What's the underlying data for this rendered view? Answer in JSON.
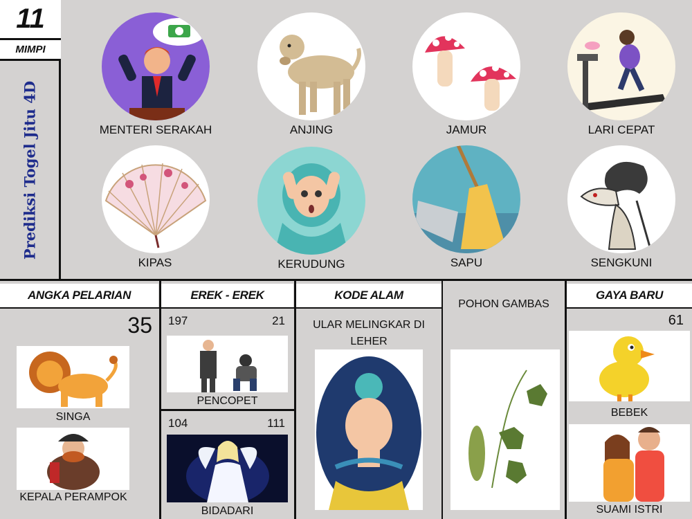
{
  "header": {
    "number": "11",
    "category": "MIMPI",
    "vertical_title": "Prediksi Togel Jitu 4D"
  },
  "dreams": [
    {
      "label": "MENTERI SERAKAH",
      "icon": "greedy-minister-icon"
    },
    {
      "label": "ANJING",
      "icon": "dog-icon"
    },
    {
      "label": "JAMUR",
      "icon": "mushroom-icon"
    },
    {
      "label": "LARI CEPAT",
      "icon": "treadmill-runner-icon"
    },
    {
      "label": "KIPAS",
      "icon": "hand-fan-icon"
    },
    {
      "label": "KERUDUNG",
      "icon": "hijab-girl-icon"
    },
    {
      "label": "SAPU",
      "icon": "broom-icon"
    },
    {
      "label": "SENGKUNI",
      "icon": "wayang-puppet-icon"
    }
  ],
  "angka_pelarian": {
    "title": "ANGKA PELARIAN",
    "number": "35",
    "items": [
      {
        "label": "SINGA",
        "icon": "lion-icon"
      },
      {
        "label": "KEPALA PERAMPOK",
        "icon": "pirate-chief-icon"
      }
    ]
  },
  "erek_erek": {
    "title": "EREK - EREK",
    "items": [
      {
        "left_number": "197",
        "right_number": "21",
        "label": "PENCOPET",
        "icon": "pickpocket-icon"
      },
      {
        "left_number": "104",
        "right_number": "111",
        "label": "BIDADARI",
        "icon": "angel-icon"
      }
    ]
  },
  "kode_alam": {
    "title": "KODE ALAM",
    "caption": "ULAR MELINGKAR DI LEHER",
    "icon": "snake-around-neck-icon"
  },
  "pohon": {
    "caption": "POHON GAMBAS",
    "icon": "luffa-plant-icon"
  },
  "gaya_baru": {
    "title": "GAYA BARU",
    "number": "61",
    "items": [
      {
        "label": "BEBEK",
        "icon": "duck-icon"
      },
      {
        "label": "SUAMI ISTRI",
        "icon": "couple-icon"
      }
    ]
  },
  "colors": {
    "title_blue": "#1e2c8c",
    "background": "#d4d2d1",
    "border": "#111111"
  }
}
